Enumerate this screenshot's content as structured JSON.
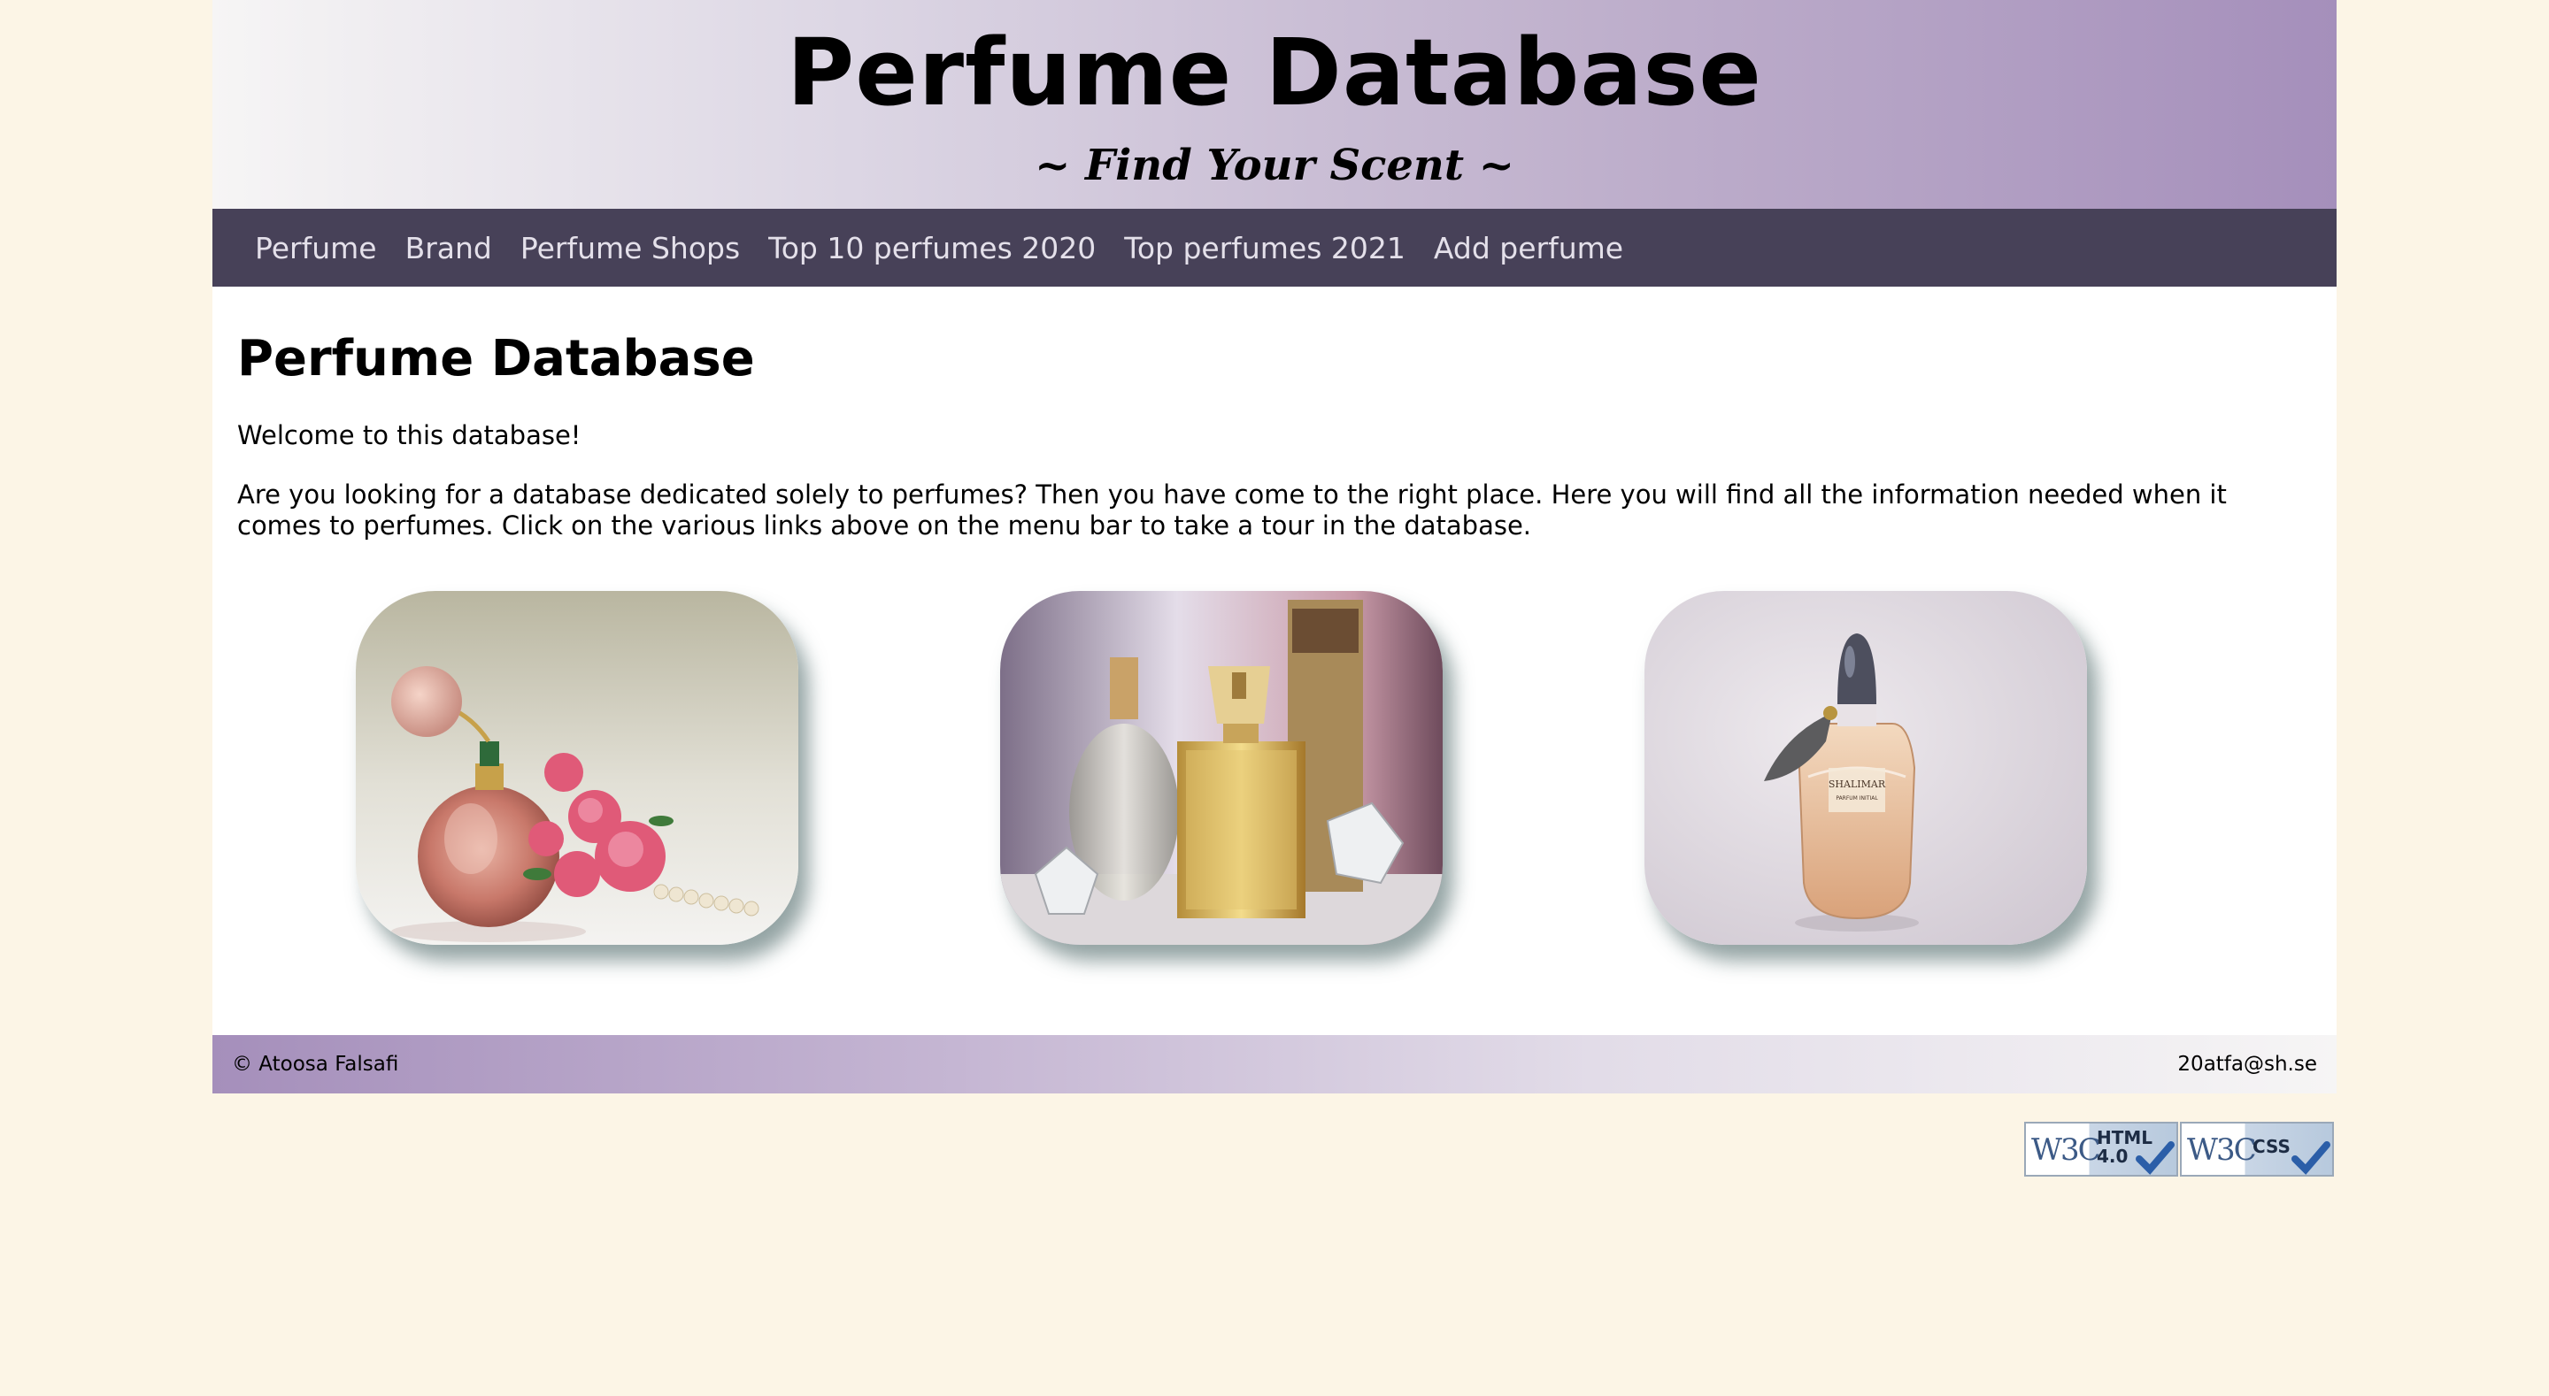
{
  "header": {
    "title": "Perfume Database",
    "tagline": "~ Find Your Scent ~"
  },
  "nav": {
    "items": [
      {
        "label": "Perfume"
      },
      {
        "label": "Brand"
      },
      {
        "label": "Perfume Shops"
      },
      {
        "label": "Top 10 perfumes 2020"
      },
      {
        "label": "Top perfumes 2021"
      },
      {
        "label": "Add perfume"
      }
    ]
  },
  "main": {
    "heading": "Perfume Database",
    "welcome": "Welcome to this database!",
    "intro": "Are you looking for a database dedicated solely to perfumes? Then you have come to the right place. Here you will find all the information needed when it comes to perfumes. Click on the various links above on the menu bar to take a tour in the database."
  },
  "gallery": {
    "photos": [
      {
        "label": "pink perfume bottle with flowers and pearls"
      },
      {
        "label": "golden perfume bottles with crystals"
      },
      {
        "label": "Shalimar perfume bottle"
      }
    ],
    "bottle_label_line1": "SHALIMAR",
    "bottle_label_line2": "PARFUM INITIAL"
  },
  "footer": {
    "copyright": "© Atoosa Falsafi",
    "email": "20atfa@sh.se"
  },
  "badges": {
    "html": {
      "logo": "W3C",
      "line1": "HTML",
      "line2": "4.0"
    },
    "css": {
      "logo": "W3C",
      "line1": "CSS"
    }
  },
  "colors": {
    "page_background": "#fcf5e6",
    "nav_background": "#474158",
    "nav_text": "#e4e0ea",
    "header_gradient_end": "#a58fbb"
  }
}
